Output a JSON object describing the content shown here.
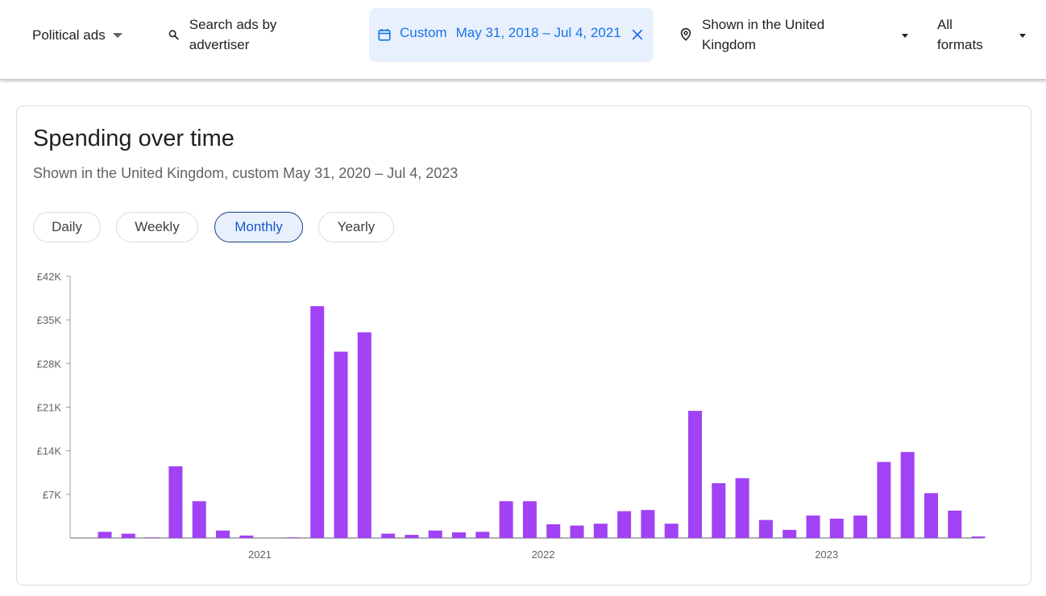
{
  "topbar": {
    "ads_type": "Political ads",
    "search_placeholder": "Search ads by advertiser",
    "date_mode": "Custom",
    "date_range": "May 31, 2018 – Jul 4, 2021",
    "region": "Shown in the United Kingdom",
    "formats": "All formats"
  },
  "card": {
    "title": "Spending over time",
    "subtitle": "Shown in the United Kingdom, custom May 31, 2020 – Jul 4, 2023",
    "granularity": [
      "Daily",
      "Weekly",
      "Monthly",
      "Yearly"
    ],
    "selected_granularity": "Monthly"
  },
  "colors": {
    "bar": "#a142f4",
    "accent": "#1a73e8",
    "chip_bg": "#e8f0fe"
  },
  "icons": {
    "political_caret": "caret-down-icon",
    "search": "search-icon",
    "calendar": "calendar-icon",
    "clear": "close-icon",
    "location": "location-pin-icon",
    "region_caret": "caret-down-icon",
    "formats_caret": "caret-down-icon"
  },
  "chart_data": {
    "type": "bar",
    "ylim": [
      0,
      42000
    ],
    "y_ticks": [
      {
        "value": 7000,
        "label": "£7K"
      },
      {
        "value": 14000,
        "label": "£14K"
      },
      {
        "value": 21000,
        "label": "£21K"
      },
      {
        "value": 28000,
        "label": "£28K"
      },
      {
        "value": 35000,
        "label": "£35K"
      },
      {
        "value": 42000,
        "label": "£42K"
      }
    ],
    "x_ticks": [
      {
        "month_index": 7,
        "label": "2021"
      },
      {
        "month_index": 19,
        "label": "2022"
      },
      {
        "month_index": 31,
        "label": "2023"
      }
    ],
    "months": [
      "Jun 2020",
      "Jul 2020",
      "Aug 2020",
      "Sep 2020",
      "Oct 2020",
      "Nov 2020",
      "Dec 2020",
      "Jan 2021",
      "Feb 2021",
      "Mar 2021",
      "Apr 2021",
      "May 2021",
      "Jun 2021",
      "Jul 2021",
      "Aug 2021",
      "Sep 2021",
      "Oct 2021",
      "Nov 2021",
      "Dec 2021",
      "Jan 2022",
      "Feb 2022",
      "Mar 2022",
      "Apr 2022",
      "May 2022",
      "Jun 2022",
      "Jul 2022",
      "Aug 2022",
      "Sep 2022",
      "Oct 2022",
      "Nov 2022",
      "Dec 2022",
      "Jan 2023",
      "Feb 2023",
      "Mar 2023",
      "Apr 2023",
      "May 2023",
      "Jun 2023",
      "Jul 2023"
    ],
    "values": [
      1000,
      700,
      100,
      11500,
      5900,
      1200,
      400,
      0,
      100,
      37200,
      29900,
      33000,
      700,
      500,
      1200,
      900,
      1000,
      5900,
      5900,
      2200,
      2000,
      2300,
      4300,
      4500,
      2300,
      20400,
      8800,
      9600,
      2900,
      1300,
      3600,
      3100,
      3600,
      12200,
      13800,
      7200,
      4400,
      250
    ]
  }
}
